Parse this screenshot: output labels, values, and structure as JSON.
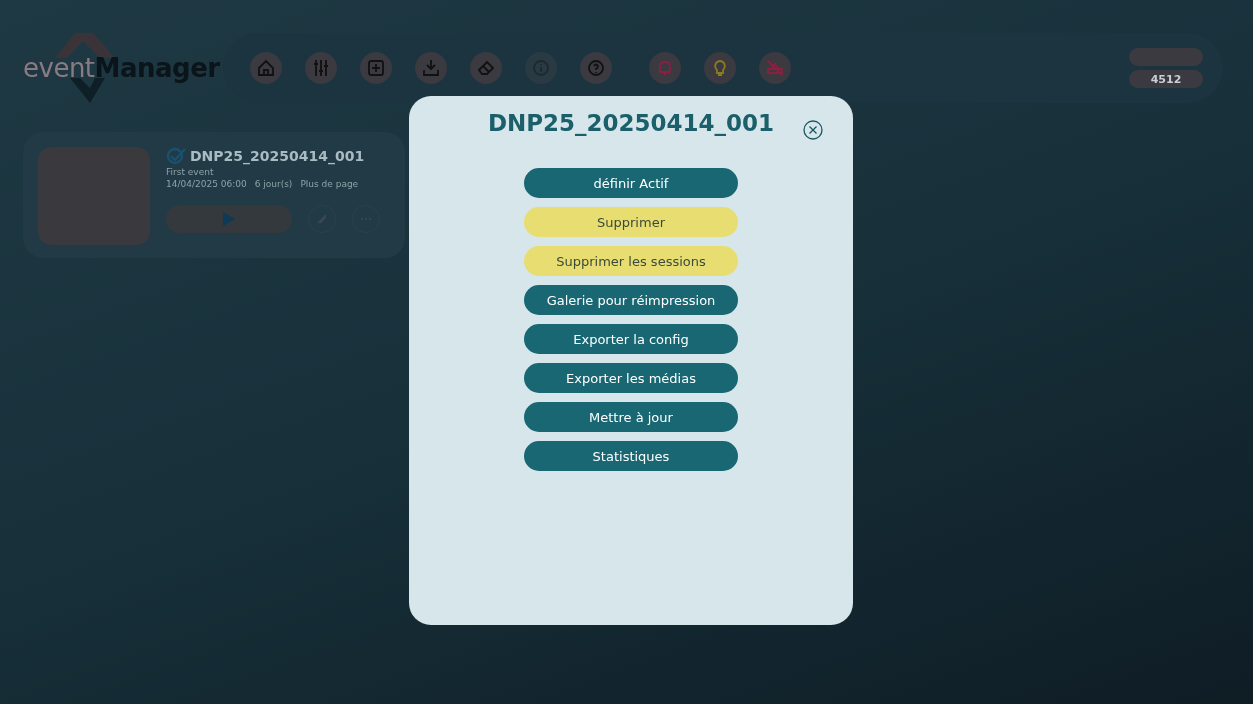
{
  "logo": {
    "part_1": "event",
    "part_2": "Manager"
  },
  "nav": [
    {
      "kind": "home",
      "disabled": false
    },
    {
      "kind": "sliders",
      "disabled": false
    },
    {
      "kind": "plus",
      "disabled": false
    },
    {
      "kind": "download",
      "disabled": false
    },
    {
      "kind": "eraser",
      "disabled": false
    },
    {
      "kind": "info",
      "disabled": true
    },
    {
      "kind": "help",
      "disabled": false
    },
    {
      "kind": "bell",
      "disabled": false,
      "color": "#8a2040"
    },
    {
      "kind": "bulb",
      "disabled": false,
      "color": "#8a7a20"
    },
    {
      "kind": "nocredit",
      "disabled": false,
      "color": "#8a2040"
    }
  ],
  "counter": {
    "value": "4512"
  },
  "event_card": {
    "checked": true,
    "title": "DNP25_20250414_001",
    "subtitle": "First event",
    "date": "14/04/2025 06:00",
    "duration": "6 jour(s)",
    "pages": "Plus de page"
  },
  "modal": {
    "title": "DNP25_20250414_001",
    "actions": [
      {
        "label": "définir Actif",
        "kind": "primary"
      },
      {
        "label": "Supprimer",
        "kind": "warning"
      },
      {
        "label": "Supprimer les sessions",
        "kind": "warning"
      },
      {
        "label": "Galerie pour réimpression",
        "kind": "primary"
      },
      {
        "label": "Exporter la config",
        "kind": "primary"
      },
      {
        "label": "Exporter les médias",
        "kind": "primary"
      },
      {
        "label": "Mettre à jour",
        "kind": "primary"
      },
      {
        "label": "Statistiques",
        "kind": "primary"
      }
    ]
  }
}
